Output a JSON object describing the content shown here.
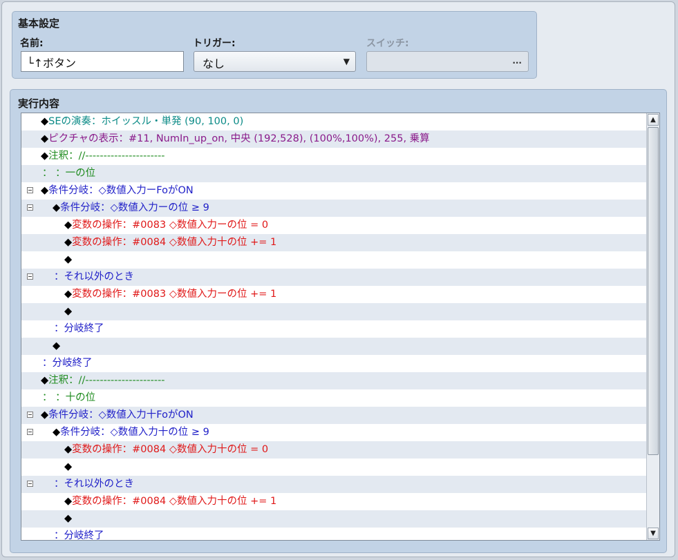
{
  "basic": {
    "title": "基本設定",
    "name_label": "名前:",
    "name_value": "└↑ボタン",
    "trigger_label": "トリガー:",
    "trigger_value": "なし",
    "switch_label": "スイッチ:",
    "switch_button": "..."
  },
  "exec": {
    "title": "実行内容",
    "rows": [
      {
        "segs": [
          {
            "t": "◆",
            "c": "black"
          },
          {
            "t": "SEの演奏：ホイッスル・単発 (90, 100, 0)",
            "c": "teal"
          }
        ],
        "indent": 28,
        "toggle": null
      },
      {
        "segs": [
          {
            "t": "◆",
            "c": "black"
          },
          {
            "t": "ピクチャの表示：#11, NumIn_up_on, 中央 (192,528), (100%,100%), 255, 乗算",
            "c": "purple"
          }
        ],
        "indent": 28,
        "toggle": null
      },
      {
        "segs": [
          {
            "t": "◆",
            "c": "black"
          },
          {
            "t": "注釈：//----------------------",
            "c": "green"
          }
        ],
        "indent": 28,
        "toggle": null
      },
      {
        "segs": [
          {
            "t": "：      ：一の位",
            "c": "green"
          }
        ],
        "indent": 30,
        "toggle": null
      },
      {
        "segs": [
          {
            "t": "◆",
            "c": "black"
          },
          {
            "t": "条件分岐：◇数値入力ーFoがON",
            "c": "blue"
          }
        ],
        "indent": 28,
        "toggle": 8
      },
      {
        "segs": [
          {
            "t": "◆",
            "c": "black"
          },
          {
            "t": "条件分岐：◇数値入力ーの位 ≥ 9",
            "c": "blue"
          }
        ],
        "indent": 45,
        "toggle": 8
      },
      {
        "segs": [
          {
            "t": "◆",
            "c": "black"
          },
          {
            "t": "変数の操作：#0083 ◇数値入力ーの位 = 0",
            "c": "red"
          }
        ],
        "indent": 62,
        "toggle": null
      },
      {
        "segs": [
          {
            "t": "◆",
            "c": "black"
          },
          {
            "t": "変数の操作：#0084 ◇数値入力十の位 += 1",
            "c": "red"
          }
        ],
        "indent": 62,
        "toggle": null
      },
      {
        "segs": [
          {
            "t": "◆",
            "c": "black"
          }
        ],
        "indent": 62,
        "toggle": null
      },
      {
        "segs": [
          {
            "t": "：それ以外のとき",
            "c": "blue"
          }
        ],
        "indent": 47,
        "toggle": 8
      },
      {
        "segs": [
          {
            "t": "◆",
            "c": "black"
          },
          {
            "t": "変数の操作：#0083 ◇数値入力ーの位 += 1",
            "c": "red"
          }
        ],
        "indent": 62,
        "toggle": null
      },
      {
        "segs": [
          {
            "t": "◆",
            "c": "black"
          }
        ],
        "indent": 62,
        "toggle": null
      },
      {
        "segs": [
          {
            "t": "：分岐終了",
            "c": "blue"
          }
        ],
        "indent": 47,
        "toggle": null
      },
      {
        "segs": [
          {
            "t": "◆",
            "c": "black"
          }
        ],
        "indent": 45,
        "toggle": null
      },
      {
        "segs": [
          {
            "t": "：分岐終了",
            "c": "blue"
          }
        ],
        "indent": 30,
        "toggle": null
      },
      {
        "segs": [
          {
            "t": "◆",
            "c": "black"
          },
          {
            "t": "注釈：//----------------------",
            "c": "green"
          }
        ],
        "indent": 28,
        "toggle": null
      },
      {
        "segs": [
          {
            "t": "：      ：十の位",
            "c": "green"
          }
        ],
        "indent": 30,
        "toggle": null
      },
      {
        "segs": [
          {
            "t": "◆",
            "c": "black"
          },
          {
            "t": "条件分岐：◇数値入力十FoがON",
            "c": "blue"
          }
        ],
        "indent": 28,
        "toggle": 8
      },
      {
        "segs": [
          {
            "t": "◆",
            "c": "black"
          },
          {
            "t": "条件分岐：◇数値入力十の位 ≥ 9",
            "c": "blue"
          }
        ],
        "indent": 45,
        "toggle": 8
      },
      {
        "segs": [
          {
            "t": "◆",
            "c": "black"
          },
          {
            "t": "変数の操作：#0084 ◇数値入力十の位 = 0",
            "c": "red"
          }
        ],
        "indent": 62,
        "toggle": null
      },
      {
        "segs": [
          {
            "t": "◆",
            "c": "black"
          }
        ],
        "indent": 62,
        "toggle": null
      },
      {
        "segs": [
          {
            "t": "：それ以外のとき",
            "c": "blue"
          }
        ],
        "indent": 47,
        "toggle": 8
      },
      {
        "segs": [
          {
            "t": "◆",
            "c": "black"
          },
          {
            "t": "変数の操作：#0084 ◇数値入力十の位 += 1",
            "c": "red"
          }
        ],
        "indent": 62,
        "toggle": null
      },
      {
        "segs": [
          {
            "t": "◆",
            "c": "black"
          }
        ],
        "indent": 62,
        "toggle": null
      },
      {
        "segs": [
          {
            "t": "：分岐終了",
            "c": "blue"
          }
        ],
        "indent": 47,
        "toggle": null
      }
    ]
  },
  "scrollbar": {
    "up_icon": "up-arrow-icon",
    "down_icon": "down-arrow-icon"
  }
}
